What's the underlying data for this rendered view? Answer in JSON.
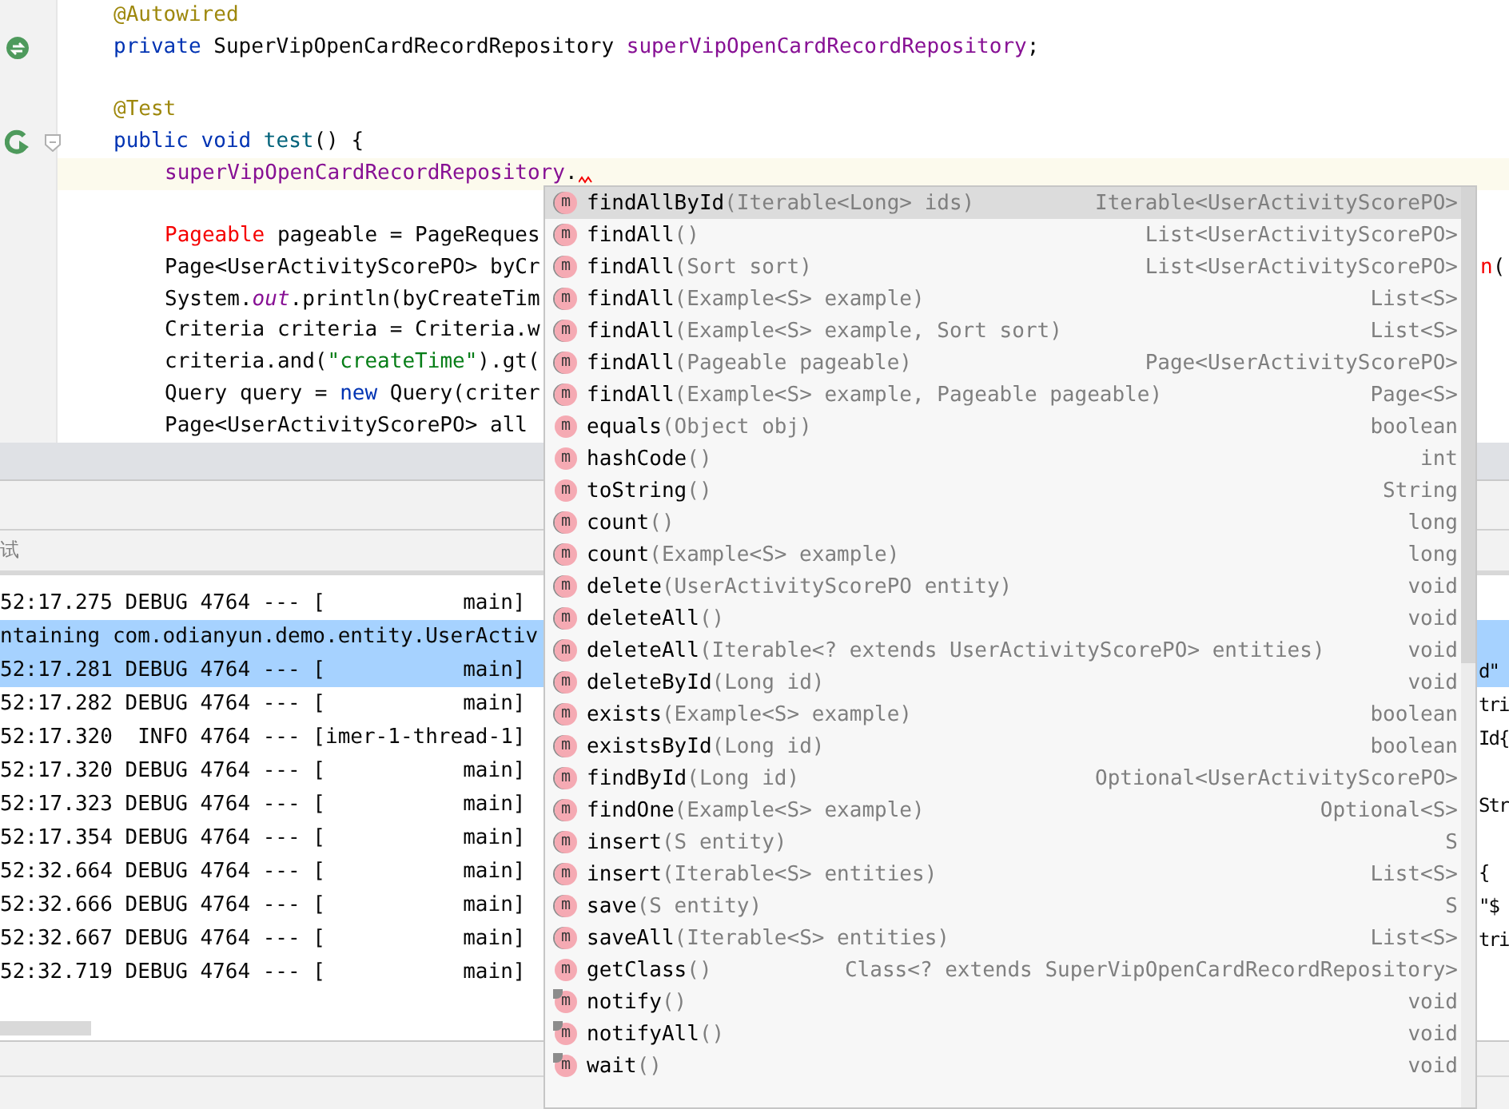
{
  "editor": {
    "lines": [
      {
        "current": false,
        "segments": [
          {
            "text": "@Autowired",
            "kind": "annotation"
          }
        ]
      },
      {
        "kind": "bean",
        "current": false,
        "segments": [
          {
            "text": "private ",
            "kind": "keyword"
          },
          {
            "text": "SuperVipOpenCardRecordRepository ",
            "kind": "plain"
          },
          {
            "text": "superVipOpenCardRecordRepository",
            "kind": "field"
          },
          {
            "text": ";",
            "kind": "plain"
          }
        ]
      },
      {
        "current": false
      },
      {
        "current": false,
        "segments": [
          {
            "text": "@Test",
            "kind": "annotation"
          }
        ]
      },
      {
        "kind": "run",
        "current": false,
        "segments": [
          {
            "text": "public void ",
            "kind": "keyword"
          },
          {
            "text": "test",
            "kind": "method"
          },
          {
            "text": "() {",
            "kind": "plain"
          }
        ],
        "children": [
          {
            "current": true,
            "error_mark": true,
            "segments": [
              {
                "text": "superVipOpenCardRecordRepository",
                "kind": "field"
              },
              {
                "text": ".",
                "kind": "plain"
              }
            ]
          },
          {
            "current": false
          },
          {
            "current": false,
            "segments": [
              {
                "text": "Pageable",
                "kind": "error"
              },
              {
                "text": " pageable = PageReques",
                "kind": "plain"
              }
            ]
          },
          {
            "current": false,
            "segments": [
              {
                "text": "Page<UserActivityScorePO> byCr",
                "kind": "plain"
              }
            ],
            "right": [
              {
                "text": "n",
                "kind": "error"
              },
              {
                "text": "(",
                "kind": "plain"
              }
            ]
          },
          {
            "current": false,
            "segments": [
              {
                "text": "System.",
                "kind": "plain"
              },
              {
                "text": "out",
                "kind": "static"
              },
              {
                "text": ".println(byCreateTim",
                "kind": "plain"
              }
            ]
          },
          {
            "current": false,
            "segments": [
              {
                "text": "Criteria criteria = Criteria.w",
                "kind": "plain"
              }
            ]
          },
          {
            "current": false,
            "segments": [
              {
                "text": "criteria.and(",
                "kind": "plain"
              },
              {
                "text": "\"createTime\"",
                "kind": "string"
              },
              {
                "text": ").gt(",
                "kind": "plain"
              }
            ]
          },
          {
            "current": false,
            "segments": [
              {
                "text": "Query query = ",
                "kind": "plain"
              },
              {
                "text": "new",
                "kind": "keyword"
              },
              {
                "text": " Query(criter",
                "kind": "plain"
              }
            ]
          },
          {
            "current": false,
            "segments": [
              {
                "text": "Page<UserActivityScorePO> all",
                "kind": "plain"
              }
            ]
          }
        ]
      }
    ]
  },
  "run_panel": {
    "tab": "试",
    "lines": [
      {
        "text": "52:17.275 DEBUG 4764 --- [           main]",
        "selected": false
      },
      {
        "text": "ntaining com.odianyun.demo.entity.UserActiv",
        "selected": true
      },
      {
        "text": "52:17.281 DEBUG 4764 --- [           main]",
        "selected": true,
        "right": "d\""
      },
      {
        "text": "52:17.282 DEBUG 4764 --- [           main]",
        "selected": false,
        "right": "tri"
      },
      {
        "text": "52:17.320  INFO 4764 --- [imer-1-thread-1]",
        "selected": false,
        "right": "Id{"
      },
      {
        "text": "52:17.320 DEBUG 4764 --- [           main]",
        "selected": false
      },
      {
        "text": "52:17.323 DEBUG 4764 --- [           main]",
        "selected": false,
        "right": "Str"
      },
      {
        "text": "52:17.354 DEBUG 4764 --- [           main]",
        "selected": false
      },
      {
        "text": "52:32.664 DEBUG 4764 --- [           main]",
        "selected": false,
        "right": "{"
      },
      {
        "text": "52:32.666 DEBUG 4764 --- [           main]",
        "selected": false,
        "right": "\"$"
      },
      {
        "text": "52:32.667 DEBUG 4764 --- [           main]",
        "selected": false,
        "right": "tri"
      },
      {
        "text": "52:32.719 DEBUG 4764 --- [           main]",
        "selected": false
      }
    ]
  },
  "completion": {
    "items": [
      {
        "icon": "m",
        "kind": "implemented",
        "name": "findAllById",
        "params": "(Iterable<Long> ids)",
        "return_type": "Iterable<UserActivityScorePO>",
        "selected": true
      },
      {
        "icon": "m",
        "kind": "implemented",
        "name": "findAll",
        "params": "()",
        "return_type": "List<UserActivityScorePO>",
        "selected": false
      },
      {
        "icon": "m",
        "kind": "implemented",
        "name": "findAll",
        "params": "(Sort sort)",
        "return_type": "List<UserActivityScorePO>",
        "selected": false
      },
      {
        "icon": "m",
        "kind": "implemented",
        "name": "findAll",
        "params": "(Example<S> example)",
        "return_type": "List<S>",
        "selected": false
      },
      {
        "icon": "m",
        "kind": "implemented",
        "name": "findAll",
        "params": "(Example<S> example, Sort sort)",
        "return_type": "List<S>",
        "selected": false
      },
      {
        "icon": "m",
        "kind": "implemented",
        "name": "findAll",
        "params": "(Pageable pageable)",
        "return_type": "Page<UserActivityScorePO>",
        "selected": false
      },
      {
        "icon": "m",
        "kind": "implemented",
        "name": "findAll",
        "params": "(Example<S> example, Pageable pageable)",
        "return_type": "Page<S>",
        "selected": false
      },
      {
        "icon": "m",
        "kind": "plain",
        "name": "equals",
        "params": "(Object obj)",
        "return_type": "boolean",
        "selected": false
      },
      {
        "icon": "m",
        "kind": "plain",
        "name": "hashCode",
        "params": "()",
        "return_type": "int",
        "selected": false
      },
      {
        "icon": "m",
        "kind": "plain",
        "name": "toString",
        "params": "()",
        "return_type": "String",
        "selected": false
      },
      {
        "icon": "m",
        "kind": "implemented",
        "name": "count",
        "params": "()",
        "return_type": "long",
        "selected": false
      },
      {
        "icon": "m",
        "kind": "implemented",
        "name": "count",
        "params": "(Example<S> example)",
        "return_type": "long",
        "selected": false
      },
      {
        "icon": "m",
        "kind": "implemented",
        "name": "delete",
        "params": "(UserActivityScorePO entity)",
        "return_type": "void",
        "selected": false
      },
      {
        "icon": "m",
        "kind": "implemented",
        "name": "deleteAll",
        "params": "()",
        "return_type": "void",
        "selected": false
      },
      {
        "icon": "m",
        "kind": "implemented",
        "name": "deleteAll",
        "params": "(Iterable<? extends UserActivityScorePO> entities)",
        "return_type": "void",
        "selected": false
      },
      {
        "icon": "m",
        "kind": "implemented",
        "name": "deleteById",
        "params": "(Long id)",
        "return_type": "void",
        "selected": false
      },
      {
        "icon": "m",
        "kind": "implemented",
        "name": "exists",
        "params": "(Example<S> example)",
        "return_type": "boolean",
        "selected": false
      },
      {
        "icon": "m",
        "kind": "implemented",
        "name": "existsById",
        "params": "(Long id)",
        "return_type": "boolean",
        "selected": false
      },
      {
        "icon": "m",
        "kind": "implemented",
        "name": "findById",
        "params": "(Long id)",
        "return_type": "Optional<UserActivityScorePO>",
        "selected": false
      },
      {
        "icon": "m",
        "kind": "implemented",
        "name": "findOne",
        "params": "(Example<S> example)",
        "return_type": "Optional<S>",
        "selected": false
      },
      {
        "icon": "m",
        "kind": "implemented",
        "name": "insert",
        "params": "(S entity)",
        "return_type": "S",
        "selected": false
      },
      {
        "icon": "m",
        "kind": "implemented",
        "name": "insert",
        "params": "(Iterable<S> entities)",
        "return_type": "List<S>",
        "selected": false
      },
      {
        "icon": "m",
        "kind": "implemented",
        "name": "save",
        "params": "(S entity)",
        "return_type": "S",
        "selected": false
      },
      {
        "icon": "m",
        "kind": "implemented",
        "name": "saveAll",
        "params": "(Iterable<S> entities)",
        "return_type": "List<S>",
        "selected": false
      },
      {
        "icon": "m",
        "kind": "plain",
        "name": "getClass",
        "params": "()",
        "return_type": "Class<? extends SuperVipOpenCardRecordRepository>",
        "selected": false
      },
      {
        "icon": "m",
        "kind": "final",
        "name": "notify",
        "params": "()",
        "return_type": "void",
        "selected": false
      },
      {
        "icon": "m",
        "kind": "final",
        "name": "notifyAll",
        "params": "()",
        "return_type": "void",
        "selected": false
      },
      {
        "icon": "m",
        "kind": "final",
        "name": "wait",
        "params": "()",
        "return_type": "void",
        "selected": false
      }
    ]
  }
}
